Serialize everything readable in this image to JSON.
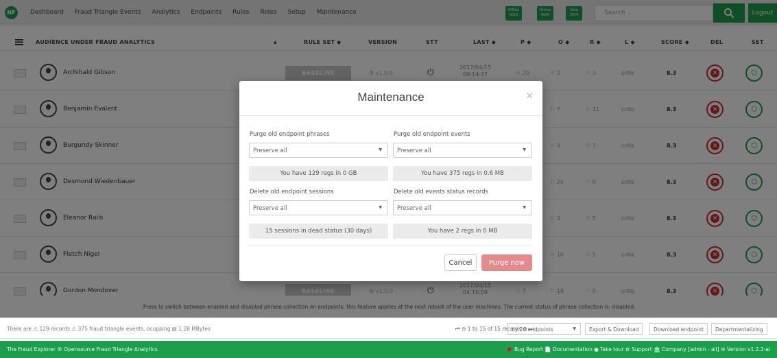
{
  "nav": {
    "logo": "NF",
    "links": [
      "Dashboard",
      "Fraud Triangle Events",
      "Analytics",
      "Endpoints",
      "Rules",
      "Roles",
      "Setup",
      "Maintenance"
    ],
    "stats": [
      {
        "top": "Offline",
        "bottom": "0015"
      },
      {
        "top": "Online",
        "bottom": "0000"
      },
      {
        "top": "Total",
        "bottom": "0015"
      }
    ],
    "search_placeholder": "Search ...",
    "logout": "Logout"
  },
  "table": {
    "headers": {
      "audience": "AUDIENCE UNDER FRAUD ANALYTICS",
      "sort_up": "▲",
      "ruleset": "RULE SET ◆",
      "version": "VERSION",
      "stt": "STT",
      "last": "LAST ◆",
      "p": "P ◆",
      "o": "O ◆",
      "r": "R ◆",
      "l": "L ◆",
      "score": "SCORE ◆",
      "del": "DEL",
      "set": "SET"
    },
    "rows": [
      {
        "name": "Archibald Gibson",
        "ruleset": "BASELINE",
        "version": "v1.0.0",
        "last": "2017/04/15 09:14:37",
        "p": "20",
        "o": "2",
        "r": "3",
        "l": "critic",
        "score": "8.3"
      },
      {
        "name": "Benjamin Evalent",
        "ruleset": "",
        "version": "",
        "last": "",
        "p": "",
        "o": "7",
        "r": "11",
        "l": "critic",
        "score": "8.3"
      },
      {
        "name": "Burgundy Skinner",
        "ruleset": "",
        "version": "",
        "last": "",
        "p": "",
        "o": "9",
        "r": "7",
        "l": "critic",
        "score": "8.3"
      },
      {
        "name": "Desmond Wiedenbauer",
        "ruleset": "",
        "version": "",
        "last": "",
        "p": "",
        "o": "25",
        "r": "0",
        "l": "critic",
        "score": "8.3"
      },
      {
        "name": "Eleanor Rails",
        "ruleset": "",
        "version": "",
        "last": "",
        "p": "",
        "o": "3",
        "r": "5",
        "l": "critic",
        "score": "8.3"
      },
      {
        "name": "Fletch Nigel",
        "ruleset": "",
        "version": "",
        "last": "",
        "p": "",
        "o": "10",
        "r": "5",
        "l": "critic",
        "score": "8.3"
      },
      {
        "name": "Gordon Mondover",
        "ruleset": "BASELINE",
        "version": "v1.0.0",
        "last": "2017/04/15 04:16:09",
        "p": "7",
        "o": "18",
        "r": "0",
        "l": "critic",
        "score": "8.3"
      }
    ]
  },
  "notice": "Press to switch between enabled and disabled phrase collection on endpoints, this feature applies at the next reboot of the user machines. The current status of phrase collection is: disabled",
  "status": {
    "summary": "There are ⚠ 129 records ⚠ 375 fraud triangle events, ocupping ▤ 1,28 MBytes",
    "pager": "⏮ ⊖ 1 to 15 of 15 records ⊕ ⏭",
    "per_page": "by 20 endpoints",
    "export": "Export & Download",
    "download": "Download endpoint",
    "departmentalizing": "Departmentalizing"
  },
  "footer": {
    "left": "The Fraud Explorer ® Opensource Fraud Triangle Analytics",
    "right": "🐞 Bug Report   📄 Documentation   ● Take tour   ⚙ Support   🏛 Company [admin - all]   ⚙ Version v1.2.2-ai"
  },
  "modal": {
    "title": "Maintenance",
    "close": "×",
    "fields": [
      {
        "label": "Purge old endpoint phrases",
        "select": "Preserve all",
        "info": "You have 129 regs in 0 GB"
      },
      {
        "label": "Purge old endpoint events",
        "select": "Preserve all",
        "info": "You have 375 regs in 0.6 MB"
      },
      {
        "label": "Delete old endpoint sessions",
        "select": "Preserve all",
        "info": "15 sessions in dead status (30 days)"
      },
      {
        "label": "Delete old events status records",
        "select": "Preserve all",
        "info": "You have 2 regs in 0 MB"
      }
    ],
    "cancel": "Cancel",
    "purge": "Purge now"
  },
  "colors": {
    "brand": "#1d9e4d",
    "danger": "#c9302c",
    "purge": "#e58a8a"
  }
}
